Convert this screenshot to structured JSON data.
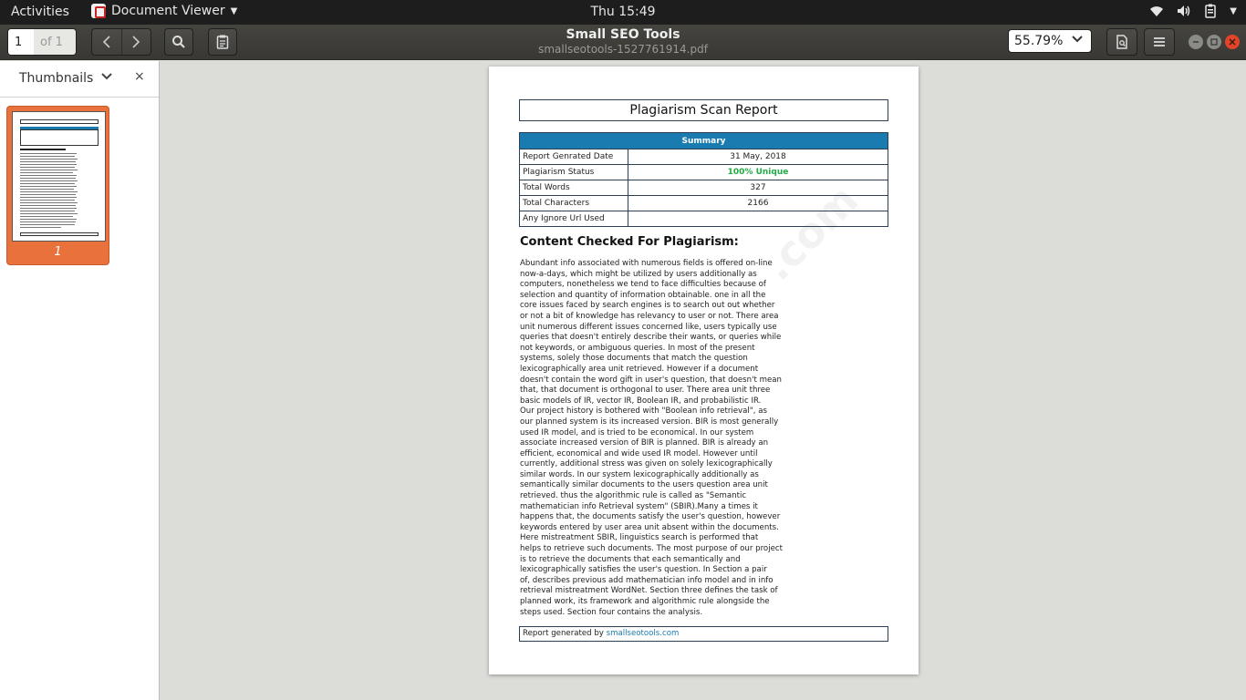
{
  "topbar": {
    "activities": "Activities",
    "app_name": "Document Viewer",
    "clock": "Thu 15:49"
  },
  "toolbar": {
    "page_number": "1",
    "page_of": "of 1",
    "doc_title": "Small SEO Tools",
    "doc_filename": "smallseotools-1527761914.pdf",
    "zoom": "55.79%"
  },
  "sidebar": {
    "label": "Thumbnails",
    "close": "×",
    "thumbnail_page": "1"
  },
  "document": {
    "title": "Plagiarism Scan Report",
    "summary_header": "Summary",
    "rows": [
      {
        "label": "Report Genrated Date",
        "value": "31 May, 2018"
      },
      {
        "label": "Plagiarism Status",
        "value": "100% Unique"
      },
      {
        "label": "Total Words",
        "value": "327"
      },
      {
        "label": "Total Characters",
        "value": "2166"
      },
      {
        "label": "Any Ignore Url Used",
        "value": ""
      }
    ],
    "content_heading": "Content Checked For Plagiarism:",
    "body": "Abundant info associated with numerous fields is offered on-line\nnow-a-days, which might be utilized by users additionally as\ncomputers, nonetheless we tend to face difficulties because of\nselection and quantity of information obtainable. one in all the\ncore issues faced by search engines is to search out out whether\nor not a bit of knowledge has relevancy to user or not. There area\nunit numerous different issues concerned like, users typically use\nqueries that doesn't entirely describe their wants, or queries while\nnot keywords, or ambiguous queries. In most of the present\nsystems, solely those documents that match the question\nlexicographically area unit retrieved. However if a document\ndoesn't contain the word gift in user's question, that doesn't mean\nthat, that document is orthogonal to user. There area unit three\nbasic models of IR, vector IR, Boolean IR, and probabilistic IR.\nOur project history is bothered with \"Boolean info retrieval\", as\nour planned system is its increased version. BIR is most generally\nused IR model, and is tried to be economical. In our system\nassociate increased version of BIR is planned. BIR is already an\nefficient, economical and wide used IR model. However until\ncurrently, additional stress was given on solely lexicographically\nsimilar words. In our system lexicographically additionally as\nsemantically similar documents to the users question area unit\nretrieved. thus the algorithmic rule is called as \"Semantic\nmathematician info Retrieval system\" (SBIR).Many a times it\nhappens that, the documents satisfy the user's question, however\nkeywords entered by user area unit absent within the documents.\nHere mistreatment SBIR, linguistics search is performed that\nhelps to retrieve such documents. The most purpose of our project\nis to retrieve the documents that each semantically and\nlexicographically satisfies the user's question. In Section a pair\nof, describes previous add mathematician info model and in info\nretrieval mistreatment WordNet. Section three defines the task of\nplanned work, its framework and algorithmic rule alongside the\nsteps used. Section four contains the analysis.",
    "footer_prefix": "Report generated by ",
    "footer_link": "smallseotools.com",
    "watermark": ".com"
  },
  "colors": {
    "accent_blue": "#1a7bb0",
    "unique_green": "#22aa44",
    "thumb_selected": "#e9713c",
    "close_red": "#e2442a"
  }
}
